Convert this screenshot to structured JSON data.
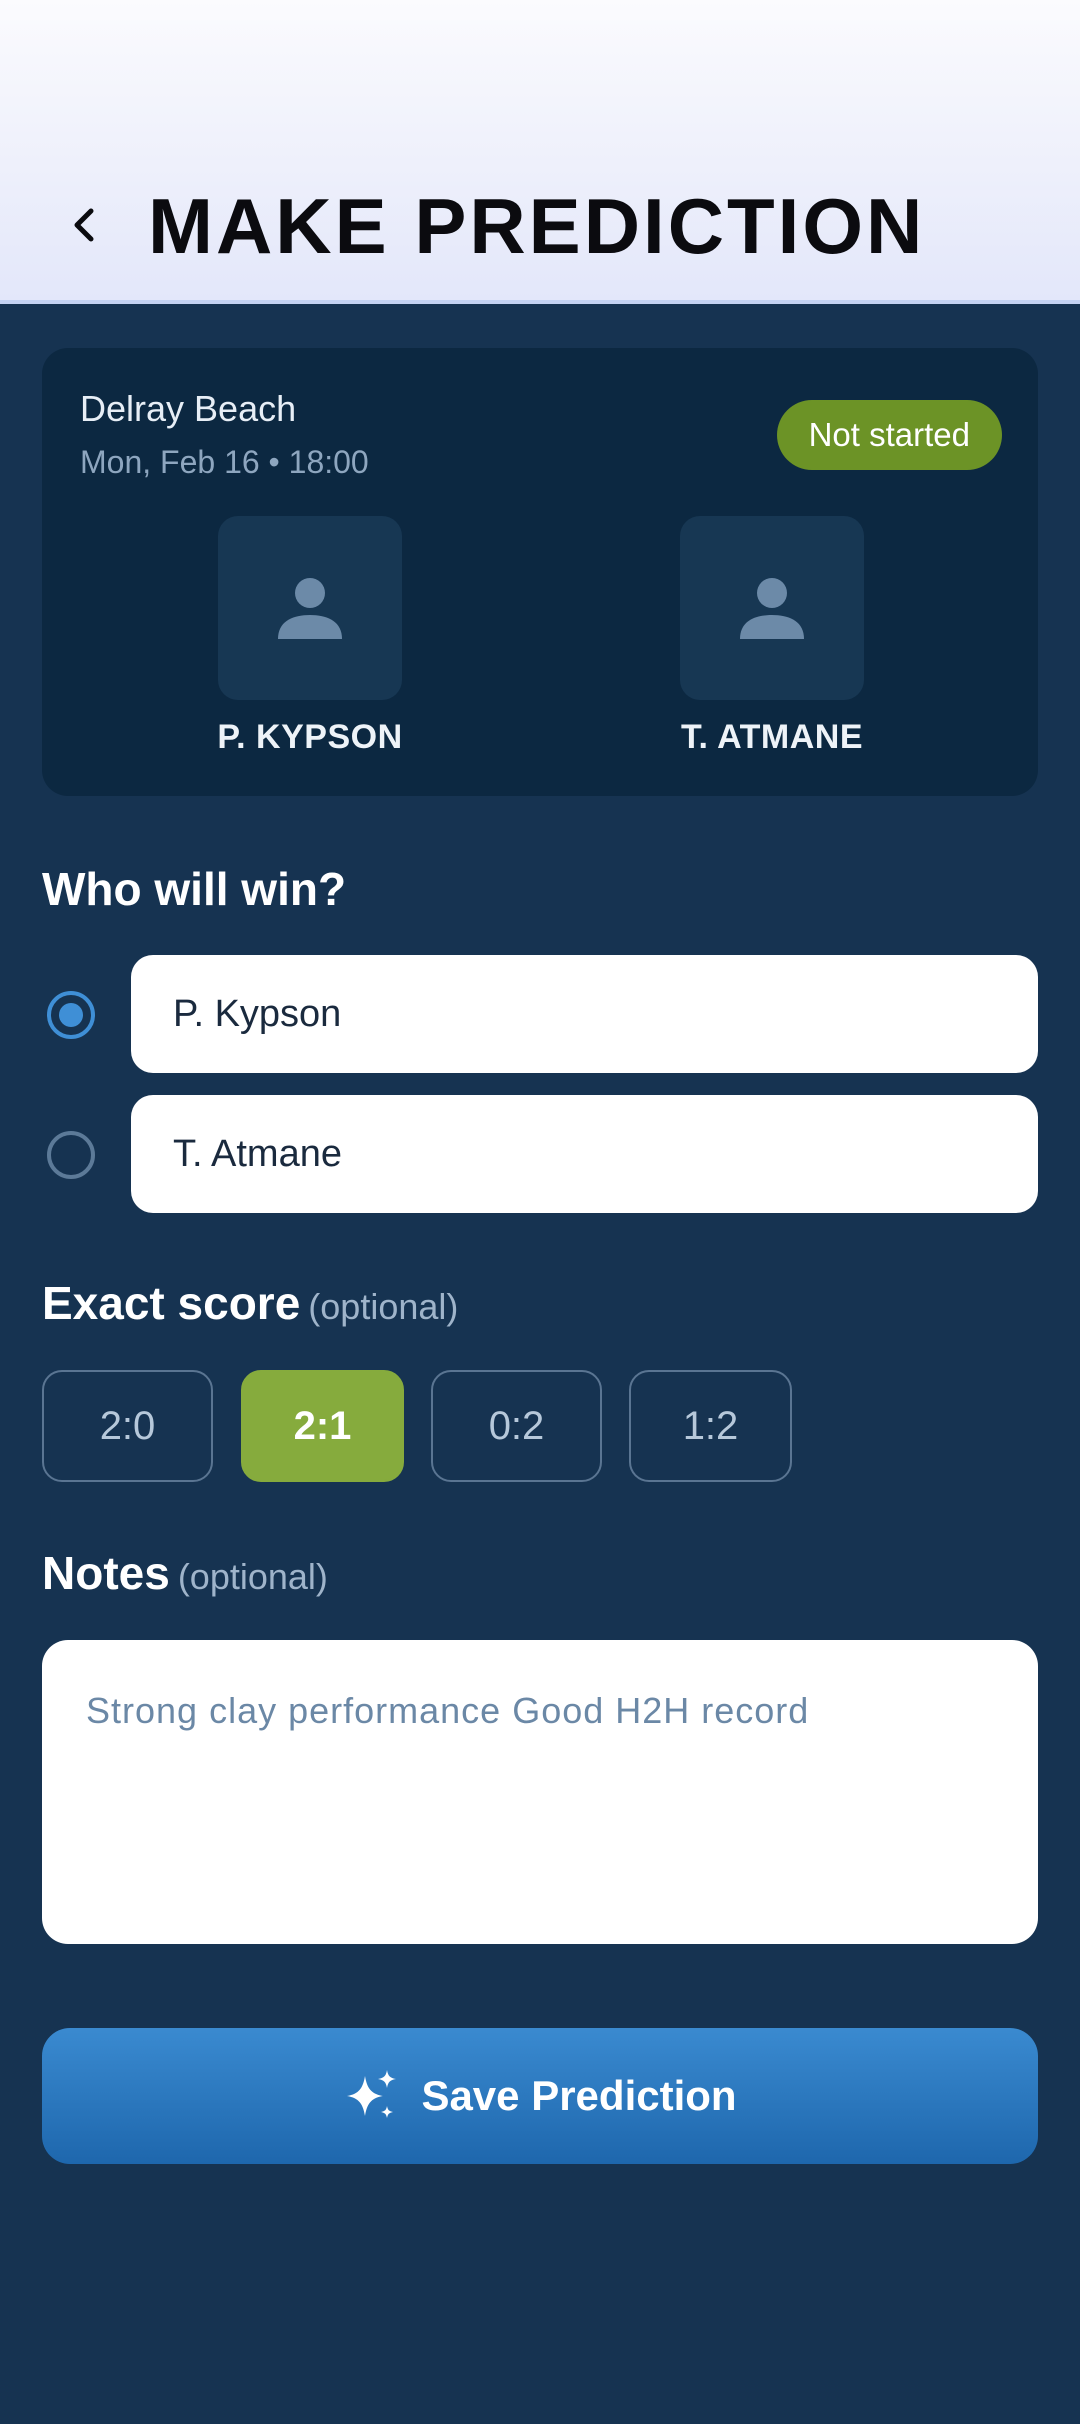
{
  "header": {
    "title": "MAKE PREDICTION",
    "back_icon": "chevron-left-icon"
  },
  "match": {
    "tournament": "Delray Beach",
    "datetime": "Mon, Feb 16 • 18:00",
    "status": "Not started",
    "status_color": "#6c9326",
    "player1": {
      "name": "P. KYPSON",
      "icon": "user-icon"
    },
    "player2": {
      "name": "T. ATMANE",
      "icon": "user-icon"
    }
  },
  "winner": {
    "title": "Who will win?",
    "options": [
      {
        "label": "P. Kypson",
        "selected": true
      },
      {
        "label": "T. Atmane",
        "selected": false
      }
    ]
  },
  "score": {
    "title": "Exact score",
    "optional": "(optional)",
    "options": [
      "2:0",
      "2:1",
      "0:2",
      "1:2"
    ],
    "selected": "2:1",
    "selected_color": "#86ab3d"
  },
  "notes": {
    "title": "Notes",
    "optional": "(optional)",
    "value": "Strong clay performance Good H2H record"
  },
  "save": {
    "label": "Save Prediction",
    "icon": "sparkles-icon"
  },
  "colors": {
    "background": "#163351",
    "card": "#0c2841",
    "accent_blue": "#3f8fd6"
  }
}
